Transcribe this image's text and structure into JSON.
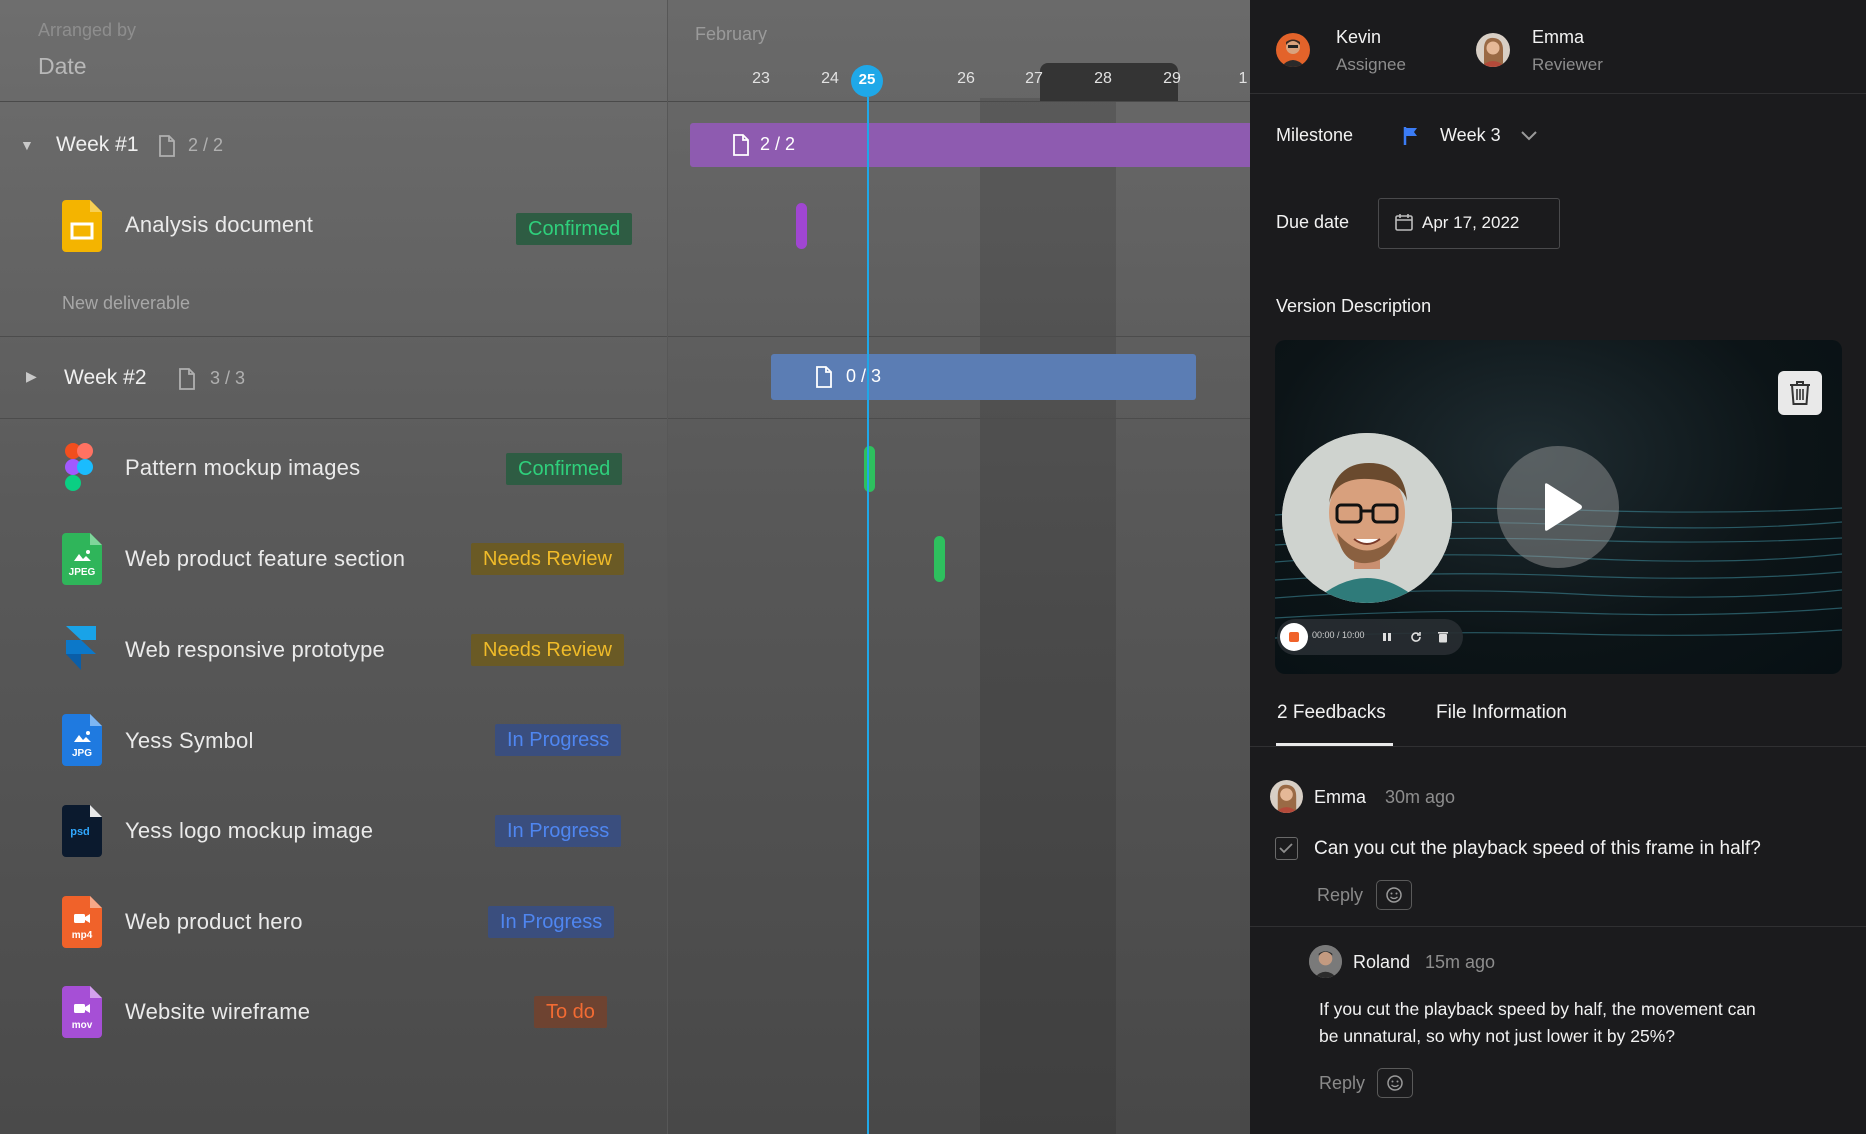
{
  "sidebar_header": {
    "arranged_label": "Arranged by",
    "arranged_value": "Date"
  },
  "timeline": {
    "month": "February",
    "days": [
      "23",
      "24",
      "25",
      "26",
      "27",
      "28",
      "29",
      "1"
    ],
    "today": "25"
  },
  "groups": [
    {
      "title": "Week #1",
      "count": "2 / 2",
      "bar_label": "2 / 2",
      "expanded": true,
      "items": [
        {
          "title": "Analysis document",
          "status": "Confirmed",
          "icon": "google-slides-icon"
        }
      ],
      "new_item": "New deliverable"
    },
    {
      "title": "Week #2",
      "count": "3 / 3",
      "bar_label": "0 / 3",
      "expanded": false,
      "items": [
        {
          "title": "Pattern mockup images",
          "status": "Confirmed",
          "icon": "figma-icon"
        },
        {
          "title": "Web product feature section",
          "status": "Needs Review",
          "icon": "jpeg-file-icon",
          "icon_text": "JPEG"
        },
        {
          "title": "Web responsive prototype",
          "status": "Needs Review",
          "icon": "framer-icon"
        },
        {
          "title": "Yess Symbol",
          "status": "In Progress",
          "icon": "jpg-file-icon",
          "icon_text": "JPG"
        },
        {
          "title": "Yess logo mockup image",
          "status": "In Progress",
          "icon": "psd-file-icon",
          "icon_text": "psd"
        },
        {
          "title": "Web product hero",
          "status": "In Progress",
          "icon": "mp4-file-icon",
          "icon_text": "mp4"
        },
        {
          "title": "Website wireframe",
          "status": "To do",
          "icon": "mov-file-icon",
          "icon_text": "mov"
        }
      ]
    }
  ],
  "panel": {
    "assignee": {
      "name": "Kevin",
      "role": "Assignee"
    },
    "reviewer": {
      "name": "Emma",
      "role": "Reviewer"
    },
    "milestone": {
      "label": "Milestone",
      "value": "Week 3"
    },
    "due_date": {
      "label": "Due date",
      "value": "Apr 17, 2022"
    },
    "version_description": "Version Description",
    "video": {
      "time": "00:00 / 10:00"
    },
    "tabs": [
      "2 Feedbacks",
      "File Information"
    ],
    "comments": [
      {
        "author": "Emma",
        "time": "30m ago",
        "text": "Can you cut the playback speed of this frame in half?",
        "reply": "Reply"
      },
      {
        "author": "Roland",
        "time": "15m ago",
        "text": "If you cut the playback speed by half, the movement can be unnatural, so why not just lower it by 25%?",
        "reply": "Reply"
      }
    ]
  },
  "colors": {
    "today": "#1fa8e8",
    "confirmed": "#2fd07c",
    "needs_review": "#f0bb29",
    "in_progress": "#4f86f0",
    "to_do": "#f26b33",
    "week1_bar": "#8e5bb0",
    "week2_bar": "#5b7db4"
  }
}
